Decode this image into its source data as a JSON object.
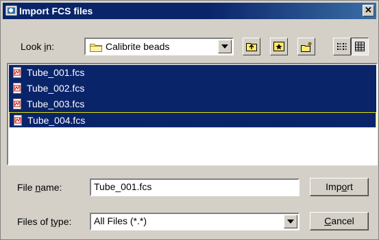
{
  "window": {
    "title": "Import FCS files",
    "close_label": "✕"
  },
  "lookin": {
    "label_pre": "Look ",
    "label_u": "i",
    "label_post": "n:",
    "value": "Calibrite beads"
  },
  "toolbar": {
    "icons": [
      "up-one-level-icon",
      "desktop-icon",
      "new-folder-icon",
      "list-view-icon",
      "details-view-icon"
    ]
  },
  "files": [
    {
      "name": "Tube_001.fcs",
      "selected": true
    },
    {
      "name": "Tube_002.fcs",
      "selected": true
    },
    {
      "name": "Tube_003.fcs",
      "selected": true
    },
    {
      "name": "Tube_004.fcs",
      "selected": true,
      "focused": true
    }
  ],
  "filename": {
    "label_pre": "File ",
    "label_u": "n",
    "label_post": "ame:",
    "value": "Tube_001.fcs"
  },
  "filetype": {
    "label_pre": "Files of ",
    "label_u": "t",
    "label_post": "ype:",
    "value": "All Files (*.*)"
  },
  "buttons": {
    "import_pre": "Imp",
    "import_u": "o",
    "import_post": "rt",
    "cancel_pre": "",
    "cancel_u": "C",
    "cancel_post": "ancel"
  },
  "colors": {
    "selection": "#0a246a",
    "titlebar": "#0a246a",
    "face": "#d4d0c8"
  }
}
